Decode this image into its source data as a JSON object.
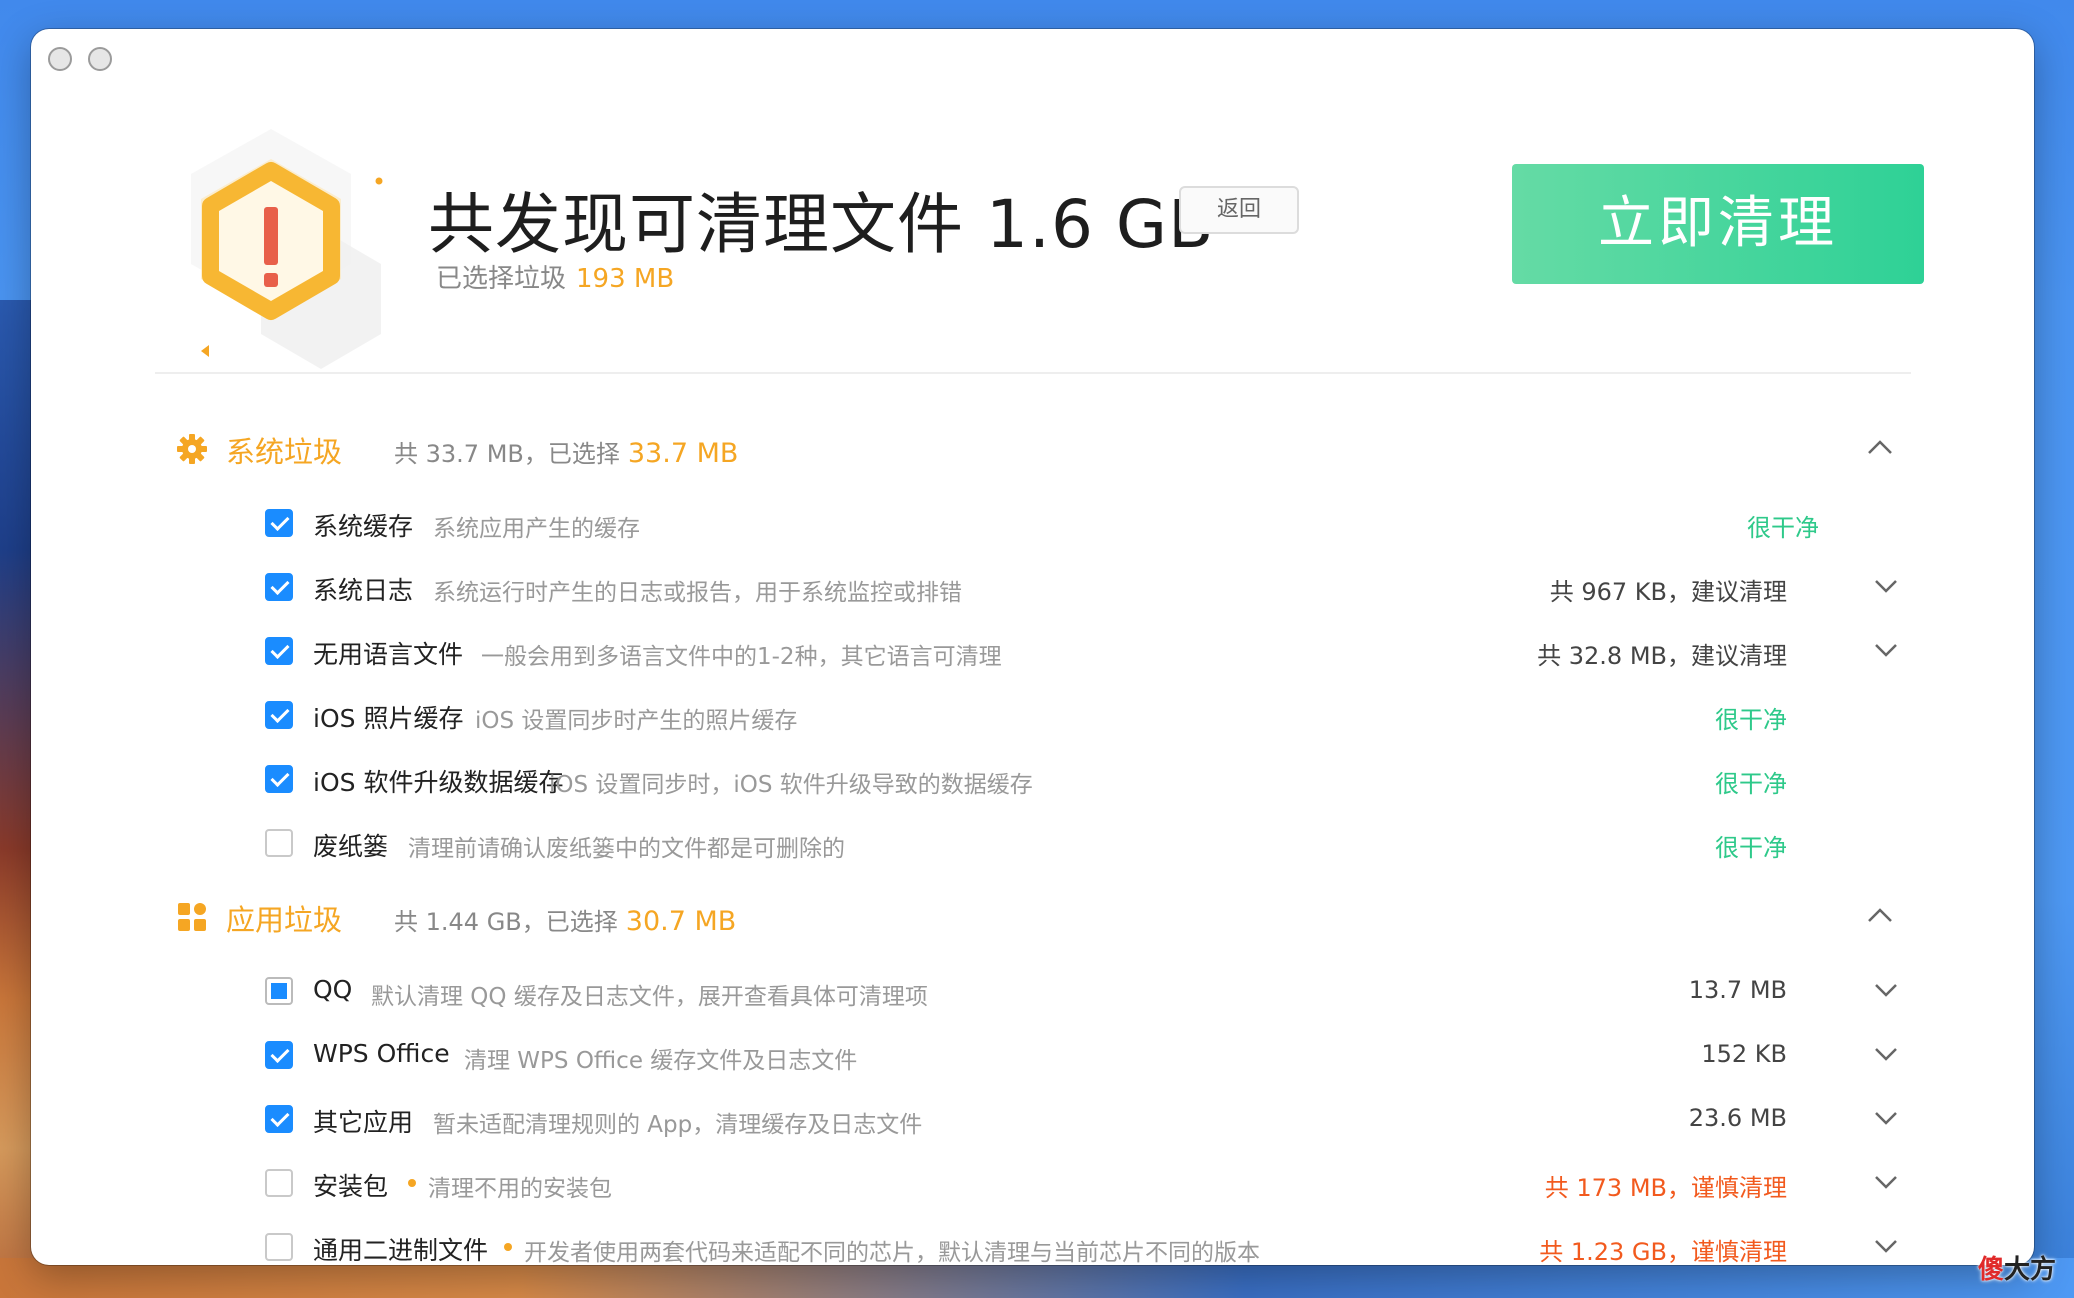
{
  "header": {
    "title": "共发现可清理文件 1.6 GB",
    "back_label": "返回",
    "selected_label": "已选择垃圾",
    "selected_amount": "193 MB",
    "clean_button": "立即清理"
  },
  "sections": [
    {
      "title": "系统垃圾",
      "summary": "共 33.7 MB，已选择",
      "selected": "33.7 MB",
      "icon": "gear-icon",
      "items": [
        {
          "name": "系统缓存",
          "desc": "系统应用产生的缓存",
          "status": "很干净",
          "checked": true
        },
        {
          "name": "系统日志",
          "desc": "系统运行时产生的日志或报告，用于系统监控或排错",
          "status": "共 967 KB，建议清理",
          "checked": true
        },
        {
          "name": "无用语言文件",
          "desc": "一般会用到多语言文件中的1-2种，其它语言可清理",
          "status": "共 32.8 MB，建议清理",
          "checked": true
        },
        {
          "name": "iOS 照片缓存",
          "desc": "iOS 设置同步时产生的照片缓存",
          "status": "很干净",
          "checked": true
        },
        {
          "name": "iOS 软件升级数据缓存",
          "desc": "iOS 设置同步时，iOS 软件升级导致的数据缓存",
          "status": "很干净",
          "checked": true
        },
        {
          "name": "废纸篓",
          "desc": "清理前请确认废纸篓中的文件都是可删除的",
          "status": "很干净",
          "checked": false
        }
      ]
    },
    {
      "title": "应用垃圾",
      "summary": "共 1.44 GB，已选择",
      "selected": "30.7 MB",
      "icon": "apps-grid-icon",
      "items": [
        {
          "name": "QQ",
          "desc": "默认清理 QQ 缓存及日志文件，展开查看具体可清理项",
          "status": "13.7 MB",
          "checked": "partial"
        },
        {
          "name": "WPS Office",
          "desc": "清理 WPS Office 缓存文件及日志文件",
          "status": "152 KB",
          "checked": true
        },
        {
          "name": "其它应用",
          "desc": "暂未适配清理规则的 App，清理缓存及日志文件",
          "status": "23.6 MB",
          "checked": true
        },
        {
          "name": "安装包",
          "desc": "清理不用的安装包",
          "status": "共 173 MB，谨慎清理",
          "checked": false
        },
        {
          "name": "通用二进制文件",
          "desc": "开发者使用两套代码来适配不同的芯片，默认清理与当前芯片不同的版本",
          "status": "共 1.23 GB，谨慎清理",
          "checked": false
        }
      ]
    }
  ],
  "watermark": {
    "part1": "傻",
    "part2": "大方"
  },
  "colors": {
    "accent_orange": "#f5a623",
    "clean_green": "#2ec98a",
    "warn_red": "#f25a1e",
    "check_blue": "#1a8cff"
  }
}
